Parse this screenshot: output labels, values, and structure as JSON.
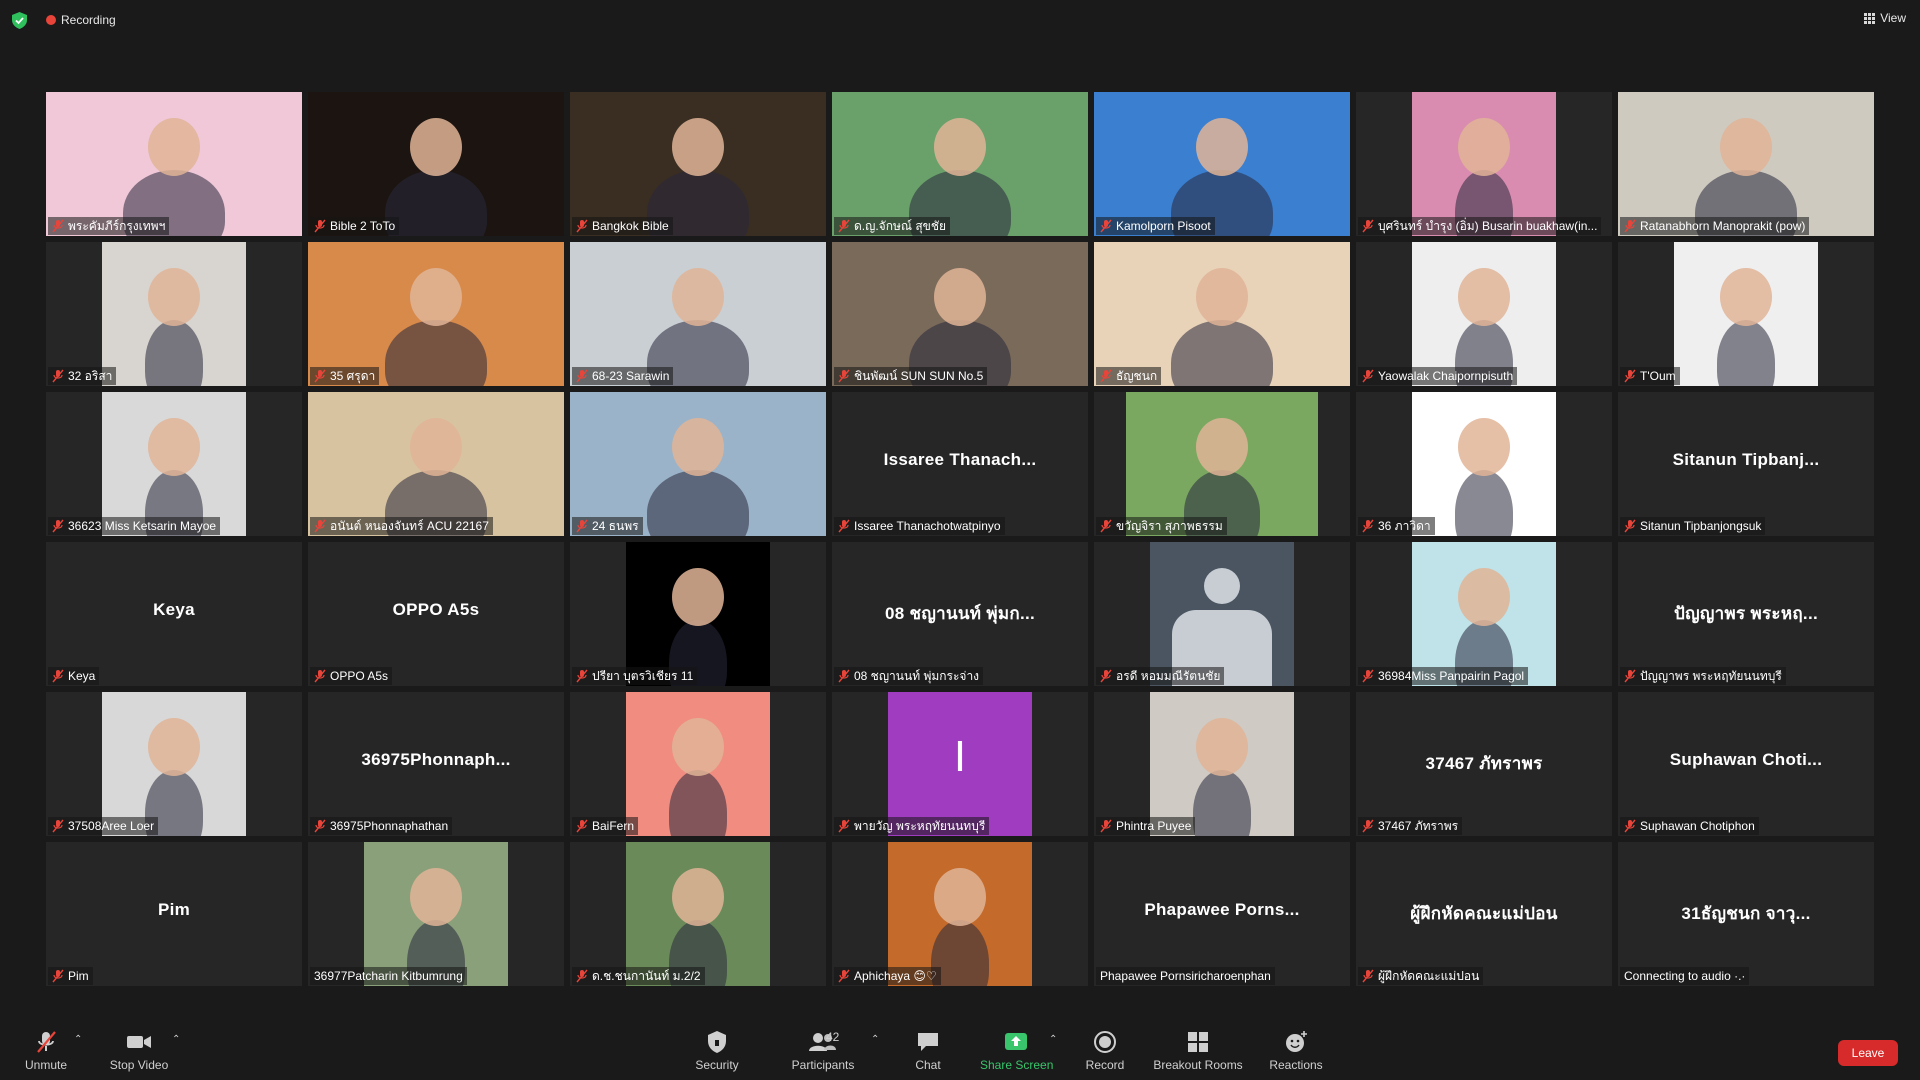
{
  "topbar": {
    "recording_label": "Recording",
    "view_label": "View"
  },
  "tiles": [
    {
      "name": "พระคัมภีร์กรุงเทพฯ",
      "bg": "#f0c8d8"
    },
    {
      "name": "Bible 2 ToTo",
      "bg": "#1b1410"
    },
    {
      "name": "Bangkok Bible",
      "bg": "#3a2e22",
      "active": true
    },
    {
      "name": "ด.ญ.จักษณ์ สุขชัย",
      "bg": "#6aa06a"
    },
    {
      "name": "Kamolporn Pisoot",
      "bg": "#3a7fd0"
    },
    {
      "name": "บุศรินทร์ บำรุง (อิ่ม) Busarin buakhaw(in...",
      "bg": "#d98cb0"
    },
    {
      "name": "Ratanabhorn Manoprakit (pow)",
      "bg": "#cfcac0"
    },
    {
      "name": "32 อริสา",
      "bg": "#d8d4cf"
    },
    {
      "name": "35 ศรุดา",
      "bg": "#d88a4a"
    },
    {
      "name": "68-23 Sarawin",
      "bg": "#c9cfd3"
    },
    {
      "name": "ชินพัฒน์ SUN SUN No.5",
      "bg": "#7a6a5a"
    },
    {
      "name": "ธัญชนก",
      "bg": "#e8d2b8"
    },
    {
      "name": "Yaowalak Chaipornpisuth",
      "bg": "#eeeeee"
    },
    {
      "name": "T'Oum",
      "bg": "#efefef"
    },
    {
      "name": "36623 Miss Ketsarin Mayoe",
      "bg": "#d9d9d9"
    },
    {
      "name": "อนันต์ หนองจันทร์ ACU 22167",
      "bg": "#d8c3a0"
    },
    {
      "name": "24 ธนพร",
      "bg": "#9bb3c8"
    },
    {
      "name": "Issaree Thanachotwatpinyo",
      "big": "Issaree  Thanach..."
    },
    {
      "name": "ขวัญจิรา สุภาพธรรม",
      "bg": "#7aa860"
    },
    {
      "name": "36 ภาวิดา",
      "bg": "#ffffff"
    },
    {
      "name": "Sitanun Tipbanjongsuk",
      "big": "Sitanun  Tipbanj..."
    },
    {
      "name": "Keya",
      "big": "Keya"
    },
    {
      "name": "OPPO A5s",
      "big": "OPPO A5s"
    },
    {
      "name": "ปรียา บุตรวิเชียร 11",
      "bg": "#000000"
    },
    {
      "name": "08 ชญานนท์ พุ่มกระจ่าง",
      "big": "08 ชญานนท์ พุ่มก..."
    },
    {
      "name": "อรดี หอมมณีรัตนชัย",
      "bg": "#4a5561"
    },
    {
      "name": "36984Miss Panpairin Pagol",
      "bg": "#bfe3e8"
    },
    {
      "name": "ปัญญาพร พระหฤทัยนนทบุรี",
      "big": "ปัญญาพร  พระหฤ..."
    },
    {
      "name": "37508Aree Loer",
      "bg": "#d8d8d8"
    },
    {
      "name": "36975Phonnaphathan",
      "big": "36975Phonnaph..."
    },
    {
      "name": "BaiFern",
      "bg": "#f08c80"
    },
    {
      "name": "พายวัญ พระหฤทัยนนทบุรี",
      "bg": "#a03cc0",
      "letter": "I"
    },
    {
      "name": "Phintra Puyee",
      "bg": "#cfcac3"
    },
    {
      "name": "37467 ภัทราพร",
      "big": "37467 ภัทราพร"
    },
    {
      "name": "Suphawan Chotiphon",
      "big": "Suphawan  Choti..."
    },
    {
      "name": "Pim",
      "big": "Pim"
    },
    {
      "name": "36977Patcharin Kitbumrung",
      "bg": "#8aa07a"
    },
    {
      "name": "ด.ช.ชนกานันท์ ม.2/2",
      "bg": "#6a8a5a"
    },
    {
      "name": "Aphichaya 😊♡",
      "bg": "#c46a2a"
    },
    {
      "name": "Phapawee Pornsiricharoenphan",
      "big": "Phapawee  Porns..."
    },
    {
      "name": "ผู้ฝึกหัดคณะแม่ปอน",
      "big": "ผู้ฝึกหัดคณะแม่ปอน"
    },
    {
      "name": "Connecting to audio ·.·",
      "big": "31ธัญชนก    จาวุ..."
    }
  ],
  "toolbar": {
    "unmute": "Unmute",
    "stop_video": "Stop Video",
    "security": "Security",
    "participants": "Participants",
    "participants_count": "42",
    "chat": "Chat",
    "share_screen": "Share Screen",
    "record": "Record",
    "breakout": "Breakout Rooms",
    "reactions": "Reactions",
    "leave": "Leave"
  },
  "colors": {
    "accent_green": "#38c56b",
    "leave_red": "#d72a2a",
    "active_border": "#e8e07a"
  }
}
